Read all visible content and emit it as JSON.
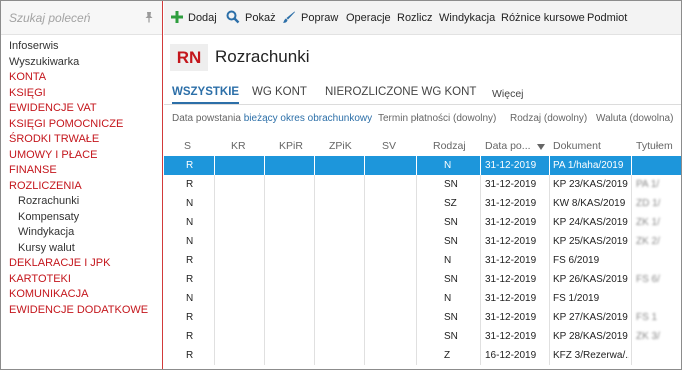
{
  "sidebar": {
    "search_placeholder": "Szukaj poleceń",
    "items": [
      {
        "label": "Infoserwis",
        "style": "plain"
      },
      {
        "label": "Wyszukiwarka",
        "style": "plain"
      },
      {
        "label": "KONTA",
        "style": "red"
      },
      {
        "label": "KSIĘGI",
        "style": "red"
      },
      {
        "label": "EWIDENCJE VAT",
        "style": "red"
      },
      {
        "label": "KSIĘGI POMOCNICZE",
        "style": "red"
      },
      {
        "label": "ŚRODKI TRWAŁE",
        "style": "red"
      },
      {
        "label": "UMOWY I PŁACE",
        "style": "red"
      },
      {
        "label": "FINANSE",
        "style": "red"
      },
      {
        "label": "ROZLICZENIA",
        "style": "red"
      },
      {
        "label": "Rozrachunki",
        "style": "sub"
      },
      {
        "label": "Kompensaty",
        "style": "sub"
      },
      {
        "label": "Windykacja",
        "style": "sub"
      },
      {
        "label": "Kursy walut",
        "style": "sub"
      },
      {
        "label": "DEKLARACJE I JPK",
        "style": "red"
      },
      {
        "label": "KARTOTEKI",
        "style": "red"
      },
      {
        "label": "KOMUNIKACJA",
        "style": "red"
      },
      {
        "label": "EWIDENCJE DODATKOWE",
        "style": "red"
      }
    ]
  },
  "toolbar": {
    "add": "Dodaj",
    "show": "Pokaż",
    "edit": "Popraw",
    "operations": "Operacje",
    "settle": "Rozlicz",
    "collection": "Windykacja",
    "fx_diff": "Różnice kursowe",
    "entity": "Podmiot"
  },
  "header": {
    "badge": "RN",
    "title": "Rozrachunki"
  },
  "tabs": {
    "all": "WSZYSTKIE",
    "by_account": "WG KONT",
    "unsettled_by_account": "NIEROZLICZONE WG KONT",
    "more": "Więcej"
  },
  "filters": {
    "created_label": "Data powstania",
    "created_value": "bieżący okres obrachunkowy",
    "due_date": "Termin płatności (dowolny)",
    "type": "Rodzaj (dowolny)",
    "currency": "Waluta (dowolna)"
  },
  "grid": {
    "headers": {
      "s": "S",
      "kr": "KR",
      "kpir": "KPiR",
      "zpik": "ZPiK",
      "sv": "SV",
      "rodzaj": "Rodzaj",
      "date": "Data po...",
      "doc": "Dokument",
      "tytul": "Tytułem"
    },
    "rows": [
      {
        "s": "R",
        "rodzaj": "N",
        "date": "31-12-2019",
        "doc": "PA 1/haha/2019",
        "tytul": "",
        "selected": true
      },
      {
        "s": "R",
        "rodzaj": "SN",
        "date": "31-12-2019",
        "doc": "KP 23/KAS/2019",
        "tytul": "PA 1/"
      },
      {
        "s": "N",
        "rodzaj": "SZ",
        "date": "31-12-2019",
        "doc": "KW 8/KAS/2019",
        "tytul": "ZD 1/"
      },
      {
        "s": "N",
        "rodzaj": "SN",
        "date": "31-12-2019",
        "doc": "KP 24/KAS/2019",
        "tytul": "ZK 1/"
      },
      {
        "s": "N",
        "rodzaj": "SN",
        "date": "31-12-2019",
        "doc": "KP 25/KAS/2019",
        "tytul": "ZK 2/"
      },
      {
        "s": "R",
        "rodzaj": "N",
        "date": "31-12-2019",
        "doc": "FS 6/2019",
        "tytul": ""
      },
      {
        "s": "R",
        "rodzaj": "SN",
        "date": "31-12-2019",
        "doc": "KP 26/KAS/2019",
        "tytul": "FS 6/"
      },
      {
        "s": "N",
        "rodzaj": "N",
        "date": "31-12-2019",
        "doc": "FS 1/2019",
        "tytul": ""
      },
      {
        "s": "R",
        "rodzaj": "SN",
        "date": "31-12-2019",
        "doc": "KP 27/KAS/2019",
        "tytul": "FS 1"
      },
      {
        "s": "R",
        "rodzaj": "SN",
        "date": "31-12-2019",
        "doc": "KP 28/KAS/2019",
        "tytul": "ZK 3/"
      },
      {
        "s": "R",
        "rodzaj": "Z",
        "date": "16-12-2019",
        "doc": "KFZ 3/Rezerwa/...",
        "tytul": ""
      }
    ]
  },
  "colors": {
    "accent_red": "#c4161c",
    "accent_blue": "#2c6fa8",
    "selection": "#1d96db",
    "add_icon": "#2e9e3e"
  }
}
